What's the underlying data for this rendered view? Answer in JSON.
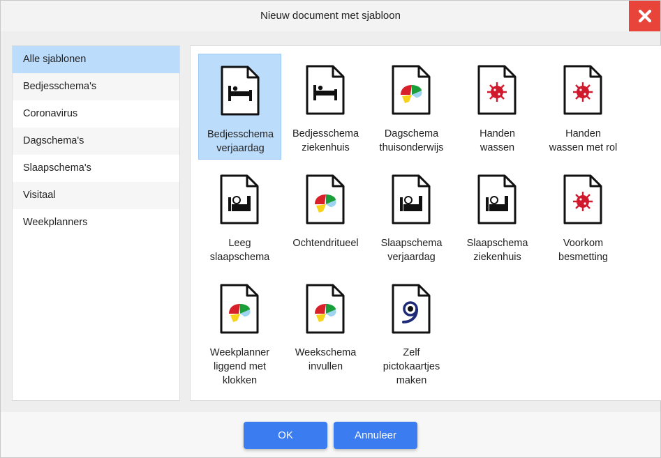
{
  "dialog": {
    "title": "Nieuw document met sjabloon",
    "close_icon": "close-x-icon"
  },
  "sidebar": {
    "items": [
      {
        "label": "Alle sjablonen",
        "active": true
      },
      {
        "label": "Bedjesschema's"
      },
      {
        "label": "Coronavirus"
      },
      {
        "label": "Dagschema's"
      },
      {
        "label": "Slaapschema's"
      },
      {
        "label": "Visitaal"
      },
      {
        "label": "Weekplanners"
      }
    ]
  },
  "templates": [
    {
      "label": "Bedjesschema\nverjaardag",
      "icon": "bed-icon",
      "selected": true
    },
    {
      "label": "Bedjesschema\nziekenhuis",
      "icon": "bed-icon"
    },
    {
      "label": "Dagschema\nthuisonderwijs",
      "icon": "colorful-logo-icon"
    },
    {
      "label": "Handen\nwassen",
      "icon": "virus-icon"
    },
    {
      "label": "Handen\nwassen met rol",
      "icon": "virus-icon"
    },
    {
      "label": "Leeg\nslaapschema",
      "icon": "sleeping-person-icon"
    },
    {
      "label": "Ochtendritueel",
      "icon": "colorful-logo-icon"
    },
    {
      "label": "Slaapschema\nverjaardag",
      "icon": "sleeping-person-icon"
    },
    {
      "label": "Slaapschema\nziekenhuis",
      "icon": "sleeping-person-icon"
    },
    {
      "label": "Voorkom\nbesmetting",
      "icon": "virus-icon"
    },
    {
      "label": "Weekplanner\nliggend met\nklokken",
      "icon": "colorful-logo-icon"
    },
    {
      "label": "Weekschema\ninvullen",
      "icon": "colorful-logo-icon"
    },
    {
      "label": "Zelf\npictokaartjes\nmaken",
      "icon": "pictogram-logo-icon"
    }
  ],
  "footer": {
    "ok_label": "OK",
    "cancel_label": "Annuleer"
  },
  "colors": {
    "accent": "#3b7cf0",
    "close": "#e8443a",
    "selected": "#bcdcfb",
    "virus": "#d0192c"
  }
}
